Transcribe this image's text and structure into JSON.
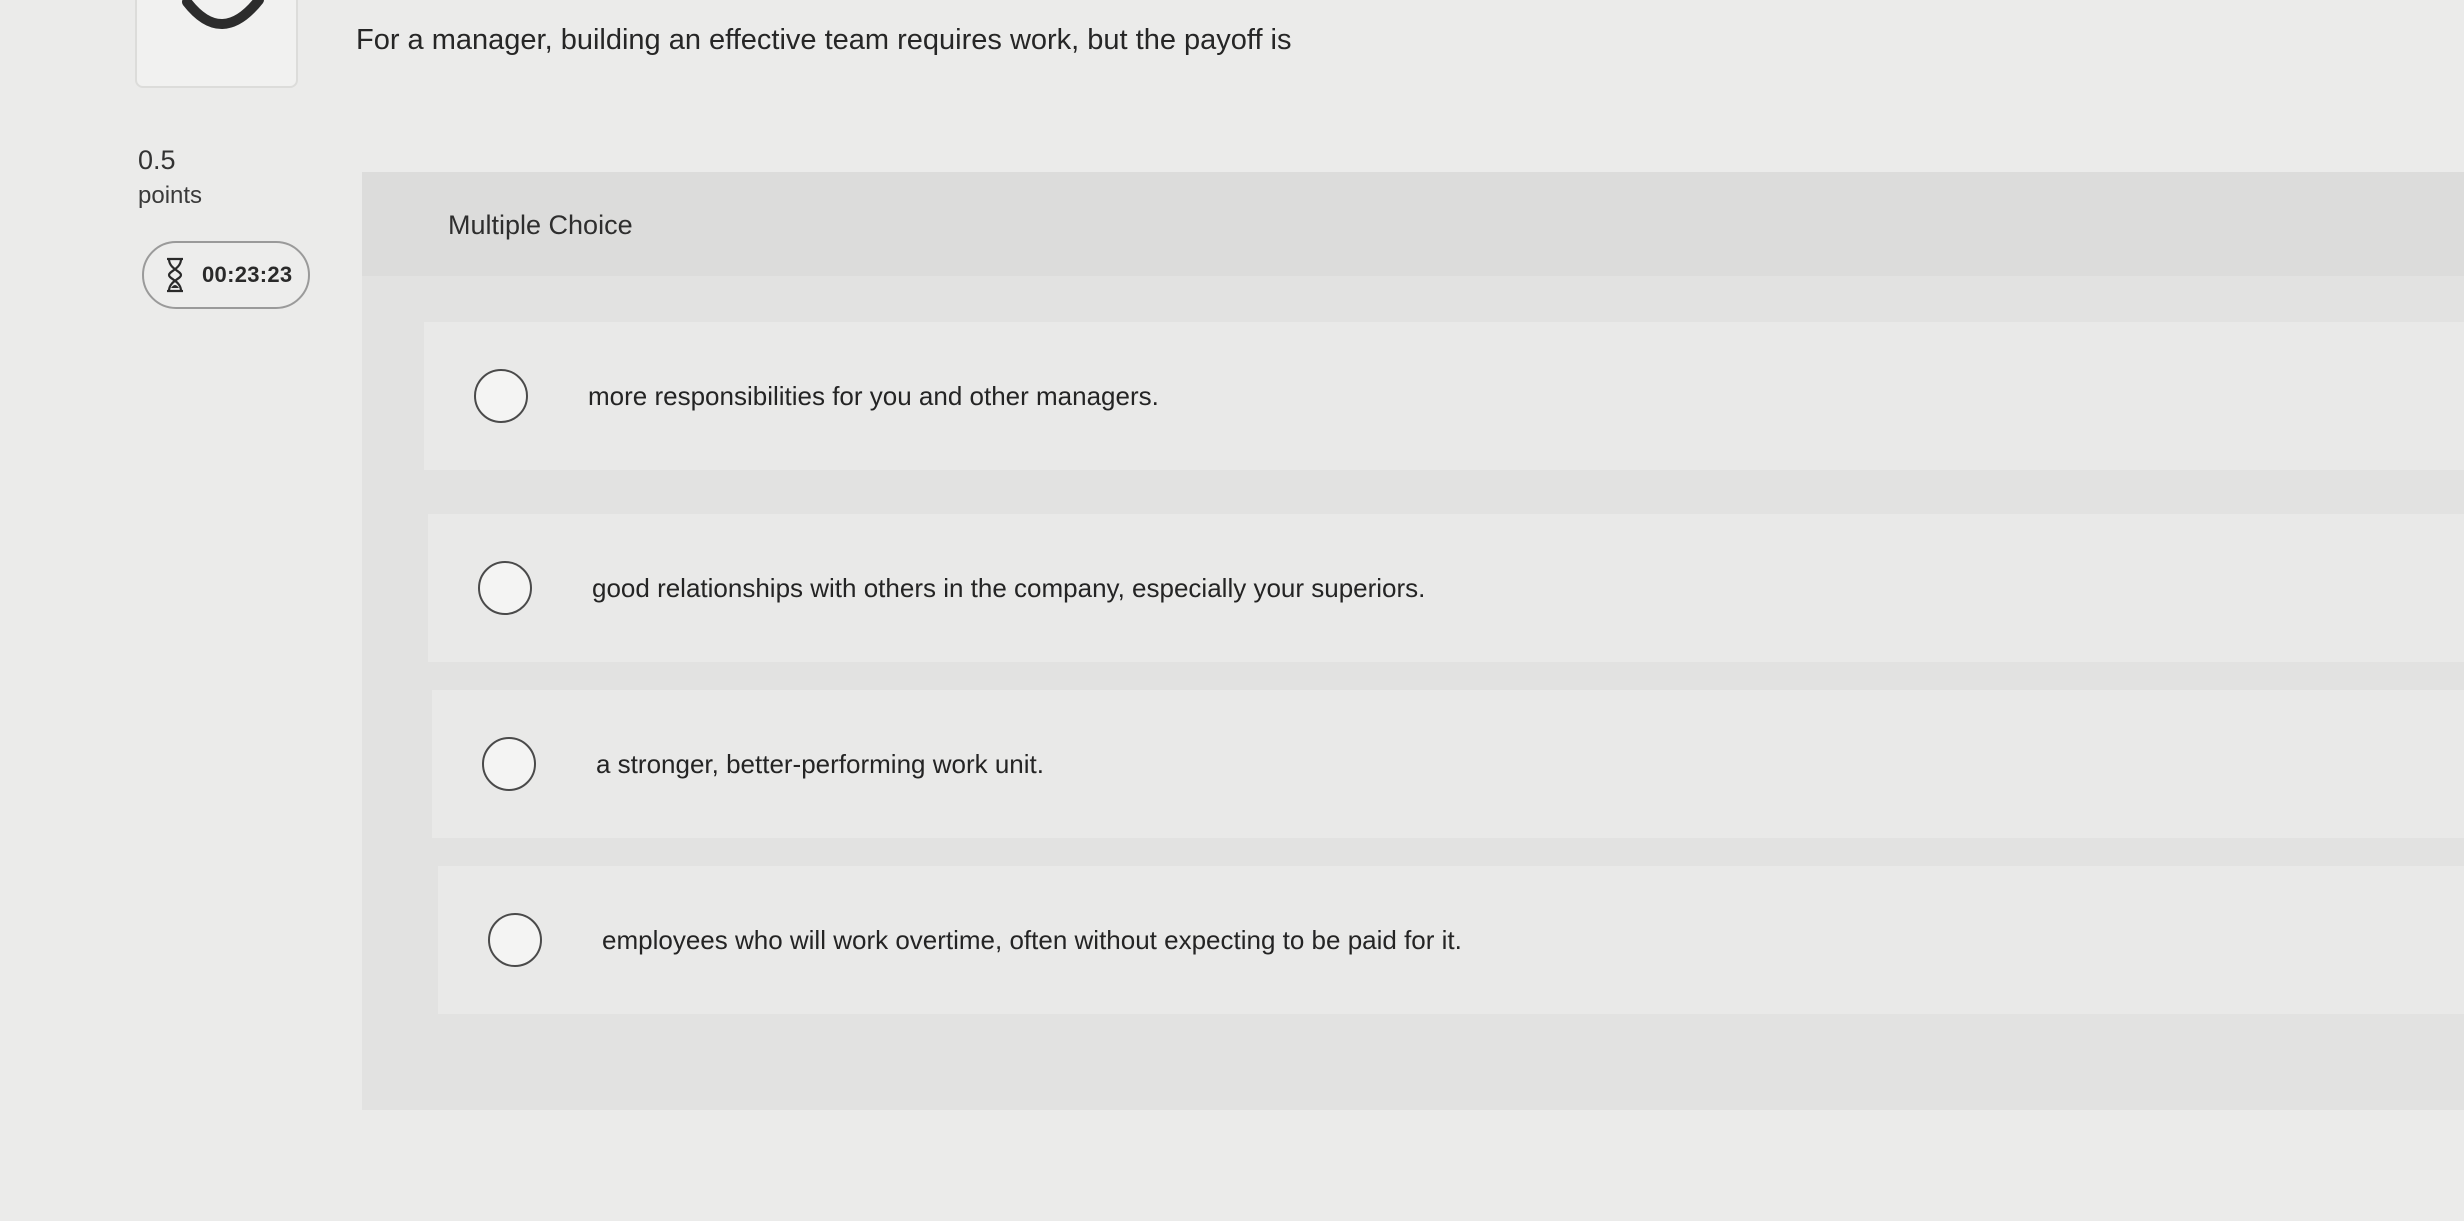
{
  "question": {
    "text": "For a manager, building an effective team requires work, but the payoff is",
    "points_value": "0.5",
    "points_label": "points",
    "timer": "00:23:23",
    "timer_icon": "hourglass-icon",
    "type_label": "Multiple Choice"
  },
  "options": [
    {
      "label": "more responsibilities for you and other managers."
    },
    {
      "label": "good relationships with others in the company, especially your superiors."
    },
    {
      "label": "a stronger, better-performing work unit."
    },
    {
      "label": "employees who will work overtime, often without expecting to be paid for it."
    }
  ],
  "colors": {
    "background": "#ebebea",
    "panel": "#e2e2e1",
    "text": "#2b2b2b"
  }
}
